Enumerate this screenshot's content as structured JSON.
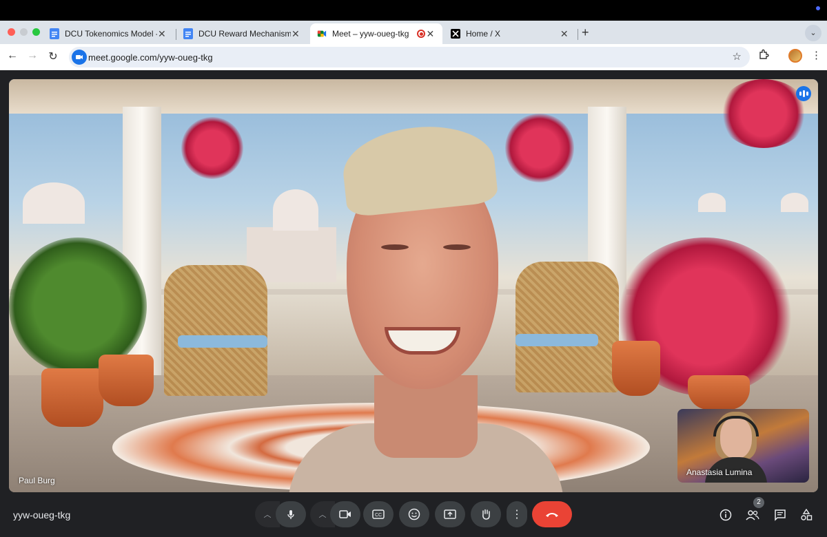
{
  "browser": {
    "tabs": [
      {
        "label": "DCU Tokenomics Model - Go",
        "icon": "google-docs-icon"
      },
      {
        "label": "DCU Reward Mechanism Spe",
        "icon": "google-docs-icon"
      },
      {
        "label": "Meet – yyw-oueg-tkg",
        "icon": "google-meet-icon",
        "active": true,
        "recording": true
      },
      {
        "label": "Home / X",
        "icon": "x-logo-icon"
      }
    ],
    "url": "meet.google.com/yyw-oueg-tkg"
  },
  "meet": {
    "main_participant": "Paul Burg",
    "pip_participant": "Anastasia Lumina",
    "meeting_code": "yyw-oueg-tkg",
    "participant_count": "2",
    "controls": [
      "mic",
      "camera",
      "captions",
      "emoji",
      "present",
      "raise-hand",
      "more",
      "leave-call"
    ],
    "right_controls": [
      "meeting-info",
      "people",
      "chat",
      "activities"
    ]
  },
  "colors": {
    "end_call": "#ea4335",
    "accent": "#1a73e8",
    "control_bg": "#3c4043",
    "stage_bg": "#202124"
  }
}
